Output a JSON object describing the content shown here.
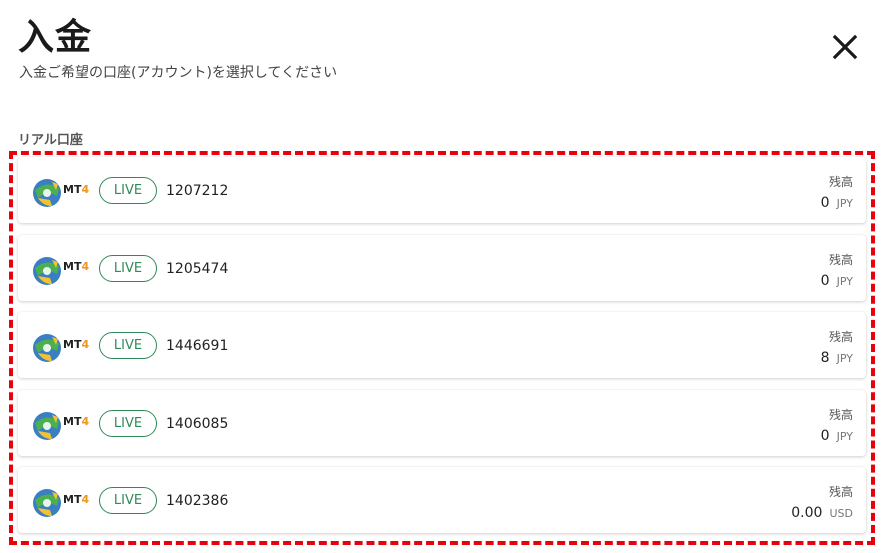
{
  "header": {
    "title": "入金",
    "subtitle": "入金ご希望の口座(アカウント)を選択してください",
    "close_icon": "close-icon"
  },
  "section": {
    "label": "リアル口座"
  },
  "colors": {
    "live_green": "#2e8b57",
    "highlight_red": "#e8000b",
    "mt4_orange": "#f0951f"
  },
  "accounts": [
    {
      "platform_mt": "MT",
      "platform_num": "4",
      "badge": "LIVE",
      "number": "1207212",
      "balance_label": "残高",
      "balance": "0",
      "currency": "JPY"
    },
    {
      "platform_mt": "MT",
      "platform_num": "4",
      "badge": "LIVE",
      "number": "1205474",
      "balance_label": "残高",
      "balance": "0",
      "currency": "JPY"
    },
    {
      "platform_mt": "MT",
      "platform_num": "4",
      "badge": "LIVE",
      "number": "1446691",
      "balance_label": "残高",
      "balance": "8",
      "currency": "JPY"
    },
    {
      "platform_mt": "MT",
      "platform_num": "4",
      "badge": "LIVE",
      "number": "1406085",
      "balance_label": "残高",
      "balance": "0",
      "currency": "JPY"
    },
    {
      "platform_mt": "MT",
      "platform_num": "4",
      "badge": "LIVE",
      "number": "1402386",
      "balance_label": "残高",
      "balance": "0.00",
      "currency": "USD"
    }
  ]
}
